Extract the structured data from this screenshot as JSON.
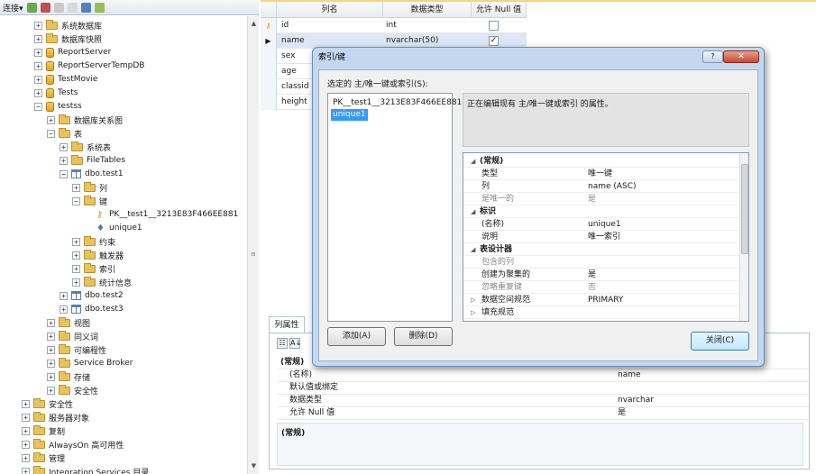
{
  "object_explorer": {
    "toolbar": {
      "connect_label": "连接▾"
    },
    "tree": [
      {
        "label": "系统数据库",
        "level": 2,
        "icon": "folder",
        "expander": "+"
      },
      {
        "label": "数据库快照",
        "level": 2,
        "icon": "folder",
        "expander": "+"
      },
      {
        "label": "ReportServer",
        "level": 2,
        "icon": "database",
        "expander": "+"
      },
      {
        "label": "ReportServerTempDB",
        "level": 2,
        "icon": "database",
        "expander": "+"
      },
      {
        "label": "TestMovie",
        "level": 2,
        "icon": "database",
        "expander": "+"
      },
      {
        "label": "Tests",
        "level": 2,
        "icon": "database",
        "expander": "+"
      },
      {
        "label": "testss",
        "level": 2,
        "icon": "database",
        "expander": "−"
      },
      {
        "label": "数据库关系图",
        "level": 3,
        "icon": "folder",
        "expander": "+"
      },
      {
        "label": "表",
        "level": 3,
        "icon": "folder",
        "expander": "−"
      },
      {
        "label": "系统表",
        "level": 4,
        "icon": "folder",
        "expander": "+"
      },
      {
        "label": "FileTables",
        "level": 4,
        "icon": "folder",
        "expander": "+"
      },
      {
        "label": "dbo.test1",
        "level": 4,
        "icon": "table",
        "expander": "−"
      },
      {
        "label": "列",
        "level": 5,
        "icon": "folder",
        "expander": "+"
      },
      {
        "label": "键",
        "level": 5,
        "icon": "folder",
        "expander": "−"
      },
      {
        "label": "PK__test1__3213E83F466EE881",
        "level": 6,
        "icon": "key",
        "expander": ""
      },
      {
        "label": "unique1",
        "level": 6,
        "icon": "index",
        "expander": ""
      },
      {
        "label": "约束",
        "level": 5,
        "icon": "folder",
        "expander": "+"
      },
      {
        "label": "触发器",
        "level": 5,
        "icon": "folder",
        "expander": "+"
      },
      {
        "label": "索引",
        "level": 5,
        "icon": "folder",
        "expander": "+"
      },
      {
        "label": "统计信息",
        "level": 5,
        "icon": "folder",
        "expander": "+"
      },
      {
        "label": "dbo.test2",
        "level": 4,
        "icon": "table",
        "expander": "+"
      },
      {
        "label": "dbo.test3",
        "level": 4,
        "icon": "table",
        "expander": "+"
      },
      {
        "label": "视图",
        "level": 3,
        "icon": "folder",
        "expander": "+"
      },
      {
        "label": "同义词",
        "level": 3,
        "icon": "folder",
        "expander": "+"
      },
      {
        "label": "可编程性",
        "level": 3,
        "icon": "folder",
        "expander": "+"
      },
      {
        "label": "Service Broker",
        "level": 3,
        "icon": "folder",
        "expander": "+"
      },
      {
        "label": "存储",
        "level": 3,
        "icon": "folder",
        "expander": "+"
      },
      {
        "label": "安全性",
        "level": 3,
        "icon": "folder",
        "expander": "+"
      },
      {
        "label": "安全性",
        "level": 1,
        "icon": "folder",
        "expander": "+"
      },
      {
        "label": "服务器对象",
        "level": 1,
        "icon": "folder",
        "expander": "+"
      },
      {
        "label": "复制",
        "level": 1,
        "icon": "folder",
        "expander": "+"
      },
      {
        "label": "AlwaysOn 高可用性",
        "level": 1,
        "icon": "folder",
        "expander": "+"
      },
      {
        "label": "管理",
        "level": 1,
        "icon": "folder",
        "expander": "+"
      },
      {
        "label": "Integration Services 目录",
        "level": 1,
        "icon": "folder",
        "expander": "+"
      }
    ]
  },
  "designer": {
    "headers": {
      "name": "列名",
      "type": "数据类型",
      "null": "允许 Null 值"
    },
    "rows": [
      {
        "name": "id",
        "type": "int",
        "allow_null": false,
        "marker": "key"
      },
      {
        "name": "name",
        "type": "nvarchar(50)",
        "allow_null": true,
        "marker": "current"
      },
      {
        "name": "sex",
        "type": "",
        "allow_null": false,
        "marker": ""
      },
      {
        "name": "age",
        "type": "",
        "allow_null": false,
        "marker": ""
      },
      {
        "name": "classid",
        "type": "",
        "allow_null": false,
        "marker": ""
      },
      {
        "name": "height",
        "type": "",
        "allow_null": false,
        "marker": ""
      }
    ],
    "props_tab": "列属性",
    "props": [
      {
        "kind": "cat",
        "key": "(常规)",
        "value": ""
      },
      {
        "kind": "row",
        "key": "(名称)",
        "value": "name"
      },
      {
        "kind": "row",
        "key": "默认值或绑定",
        "value": ""
      },
      {
        "kind": "row",
        "key": "数据类型",
        "value": "nvarchar"
      },
      {
        "kind": "row",
        "key": "允许 Null 值",
        "value": "是"
      }
    ],
    "props_desc": "(常规)"
  },
  "dialog": {
    "title": "索引/键",
    "help_label": "?",
    "close_x": "✕",
    "selected_label": "选定的 主/唯一键或索引(S):",
    "items": [
      {
        "label": "PK__test1__3213E83F466EE881",
        "selected": false
      },
      {
        "label": "unique1",
        "selected": true
      }
    ],
    "info_text": "正在编辑现有 主/唯一键或索引 的属性。",
    "grid": [
      {
        "kind": "cat",
        "key": "(常规)",
        "value": "",
        "tri": "◢"
      },
      {
        "kind": "row",
        "key": "类型",
        "value": "唯一键",
        "muted": false
      },
      {
        "kind": "row",
        "key": "列",
        "value": "name (ASC)",
        "muted": false
      },
      {
        "kind": "row",
        "key": "是唯一的",
        "value": "是",
        "muted": true
      },
      {
        "kind": "cat",
        "key": "标识",
        "value": "",
        "tri": "◢"
      },
      {
        "kind": "row",
        "key": "(名称)",
        "value": "unique1",
        "muted": false
      },
      {
        "kind": "row",
        "key": "说明",
        "value": "唯一索引",
        "muted": false
      },
      {
        "kind": "cat",
        "key": "表设计器",
        "value": "",
        "tri": "◢"
      },
      {
        "kind": "row",
        "key": "包含的列",
        "value": "",
        "muted": true
      },
      {
        "kind": "row",
        "key": "创建为聚集的",
        "value": "是",
        "muted": false
      },
      {
        "kind": "row",
        "key": "忽略重复键",
        "value": "否",
        "muted": true
      },
      {
        "kind": "sub",
        "key": "数据空间规范",
        "value": "PRIMARY",
        "tri": "▷"
      },
      {
        "kind": "sub",
        "key": "填充规范",
        "value": "",
        "tri": "▷"
      }
    ],
    "add_button": "添加(A)",
    "delete_button": "删除(D)",
    "close_button": "关闭(C)"
  }
}
